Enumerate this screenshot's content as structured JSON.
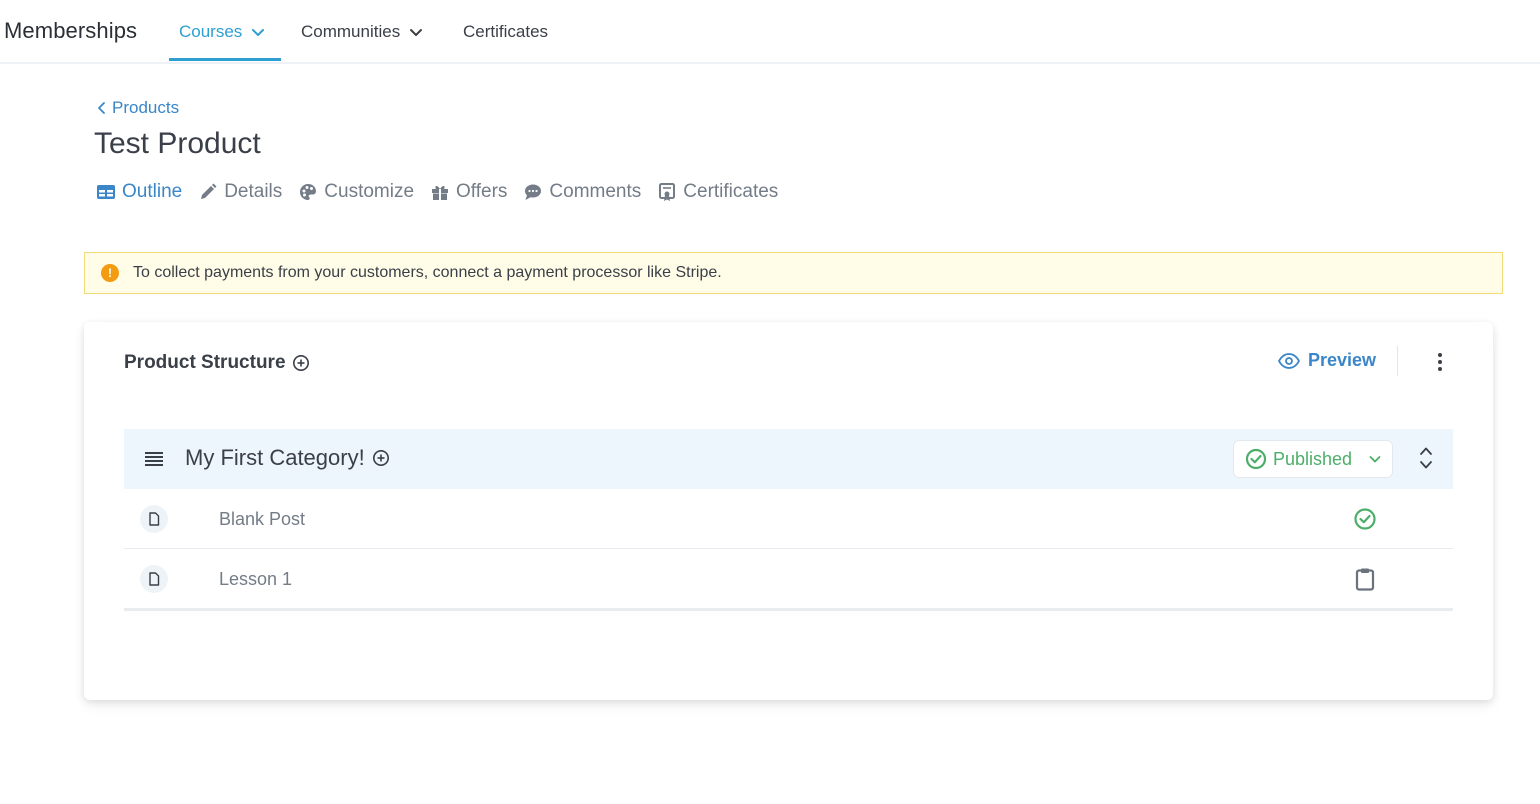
{
  "app": {
    "brand": "Memberships"
  },
  "topnav": {
    "tabs": [
      {
        "label": "Courses",
        "active": true,
        "has_dropdown": true
      },
      {
        "label": "Communities",
        "active": false,
        "has_dropdown": true
      },
      {
        "label": "Certificates",
        "active": false,
        "has_dropdown": false
      }
    ]
  },
  "breadcrumb": {
    "back_label": "Products"
  },
  "page": {
    "title": "Test Product"
  },
  "subtabs": [
    {
      "label": "Outline",
      "icon": "table-icon",
      "active": true
    },
    {
      "label": "Details",
      "icon": "pencil-icon",
      "active": false
    },
    {
      "label": "Customize",
      "icon": "palette-icon",
      "active": false
    },
    {
      "label": "Offers",
      "icon": "gift-icon",
      "active": false
    },
    {
      "label": "Comments",
      "icon": "comment-icon",
      "active": false
    },
    {
      "label": "Certificates",
      "icon": "certificate-icon",
      "active": false
    }
  ],
  "alert": {
    "icon": "exclamation-icon",
    "text": "To collect payments from your customers, connect a payment processor like Stripe."
  },
  "structure": {
    "title": "Product Structure",
    "preview_label": "Preview",
    "category": {
      "title": "My First Category!",
      "status": "Published"
    },
    "items": [
      {
        "label": "Blank Post",
        "status_icon": "check-circle-icon"
      },
      {
        "label": "Lesson 1",
        "status_icon": "clipboard-icon"
      }
    ]
  },
  "colors": {
    "accent": "#2e9fd0",
    "link": "#3a86c8",
    "success": "#4cae68",
    "warning": "#f39c12",
    "alert_bg": "#fffde8",
    "category_bg": "#eef6fd"
  }
}
